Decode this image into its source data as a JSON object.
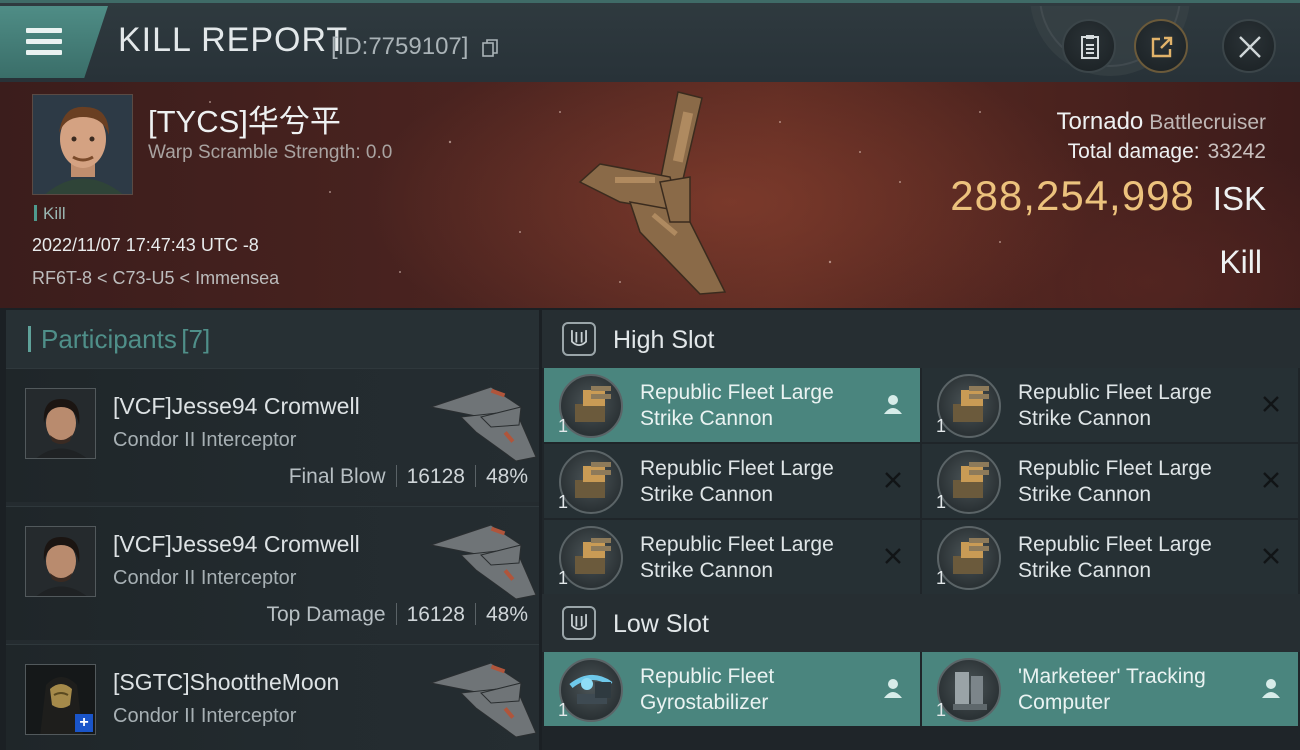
{
  "header": {
    "title": "KILL REPORT",
    "report_id": "[ID:7759107]"
  },
  "victim": {
    "name": "[TYCS]华兮平",
    "scramble": "Warp Scramble Strength: 0.0",
    "tag": "Kill",
    "datetime": "2022/11/07 17:47:43 UTC -8",
    "location": "RF6T-8 < C73-U5 < Immensea",
    "ship_name": "Tornado",
    "ship_class": "Battlecruiser",
    "damage_label": "Total damage:",
    "damage_value": "33242",
    "isk_value": "288,254,998",
    "isk_unit": "ISK",
    "result": "Kill"
  },
  "participants": {
    "label": "Participants",
    "count": "[7]",
    "rows": [
      {
        "name": "[VCF]Jesse94 Cromwell",
        "ship": "Condor II Interceptor",
        "stat_label": "Final Blow",
        "damage": "16128",
        "percent": "48%"
      },
      {
        "name": "[VCF]Jesse94 Cromwell",
        "ship": "Condor II Interceptor",
        "stat_label": "Top Damage",
        "damage": "16128",
        "percent": "48%"
      },
      {
        "name": "[SGTC]ShoottheMoon",
        "ship": "Condor II Interceptor"
      }
    ]
  },
  "fitting": {
    "high_slot_label": "High Slot",
    "low_slot_label": "Low Slot",
    "high": [
      {
        "name_line1": "Republic Fleet Large",
        "name_line2": "Strike Cannon",
        "qty": "1",
        "status": "pilot-icon"
      },
      {
        "name_line1": "Republic Fleet Large",
        "name_line2": "Strike Cannon",
        "qty": "1",
        "status": "x-icon"
      },
      {
        "name_line1": "Republic Fleet Large",
        "name_line2": "Strike Cannon",
        "qty": "1",
        "status": "x-icon"
      },
      {
        "name_line1": "Republic Fleet Large",
        "name_line2": "Strike Cannon",
        "qty": "1",
        "status": "x-icon"
      },
      {
        "name_line1": "Republic Fleet Large",
        "name_line2": "Strike Cannon",
        "qty": "1",
        "status": "x-icon"
      },
      {
        "name_line1": "Republic Fleet Large",
        "name_line2": "Strike Cannon",
        "qty": "1",
        "status": "x-icon"
      }
    ],
    "low": [
      {
        "name_line1": "Republic Fleet",
        "name_line2": "Gyrostabilizer",
        "qty": "1",
        "status": "pilot-icon"
      },
      {
        "name_line1": "'Marketeer' Tracking",
        "name_line2": "Computer",
        "qty": "1",
        "status": "pilot-icon"
      }
    ]
  },
  "colors": {
    "accent_teal": "#4a857e",
    "isk_gold": "#ecc27d"
  }
}
